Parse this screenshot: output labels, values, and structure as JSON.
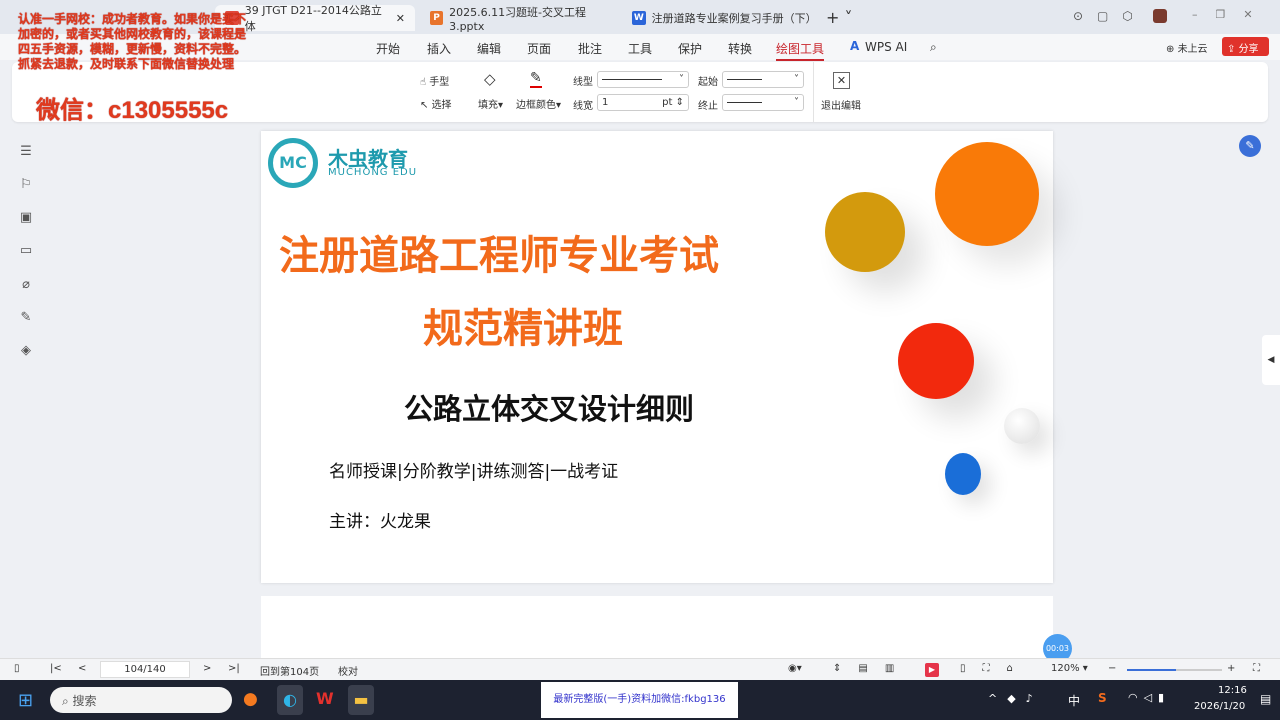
{
  "tabs": [
    {
      "label": "39 JTGT D21--2014公路立体",
      "icon": "pdf-icon"
    },
    {
      "label": "2025.6.11习题班-交叉工程3.pptx",
      "icon": "ppt-icon"
    },
    {
      "label": "注册道路专业案例复习手册（下）",
      "icon": "word-icon"
    }
  ],
  "menu": [
    "开始",
    "插入",
    "编辑",
    "页面",
    "批注",
    "工具",
    "保护",
    "转换",
    "绘图工具",
    "WPS AI"
  ],
  "menu_right": {
    "cloud": "未上云",
    "share": "分享"
  },
  "toolbar": {
    "hand": "手型",
    "select": "选择",
    "fill": "填充",
    "border_color": "边框颜色",
    "line_type": "线型",
    "line_width": "线宽",
    "width_value": "1",
    "unit": "pt",
    "start": "起始",
    "end": "终止",
    "exit": "退出编辑"
  },
  "overlay": {
    "text": "认准一手网校：成功者教育。如果你是买不加密的，或者买其他网校教育的，该课程是四五手资源，模糊，更新慢，资料不完整。抓紧去退款，及时联系下面微信替换处理",
    "wechat": "微信：c1305555c"
  },
  "slide": {
    "logo_cn": "木虫教育",
    "logo_en": "MUCHONG EDU",
    "logo_mark": "MC",
    "title1": "注册道路工程师专业考试",
    "title2": "规范精讲班",
    "subtitle": "公路立体交叉设计细则",
    "tagline": "名师授课|分阶教学|讲练测答|一战考证",
    "lecturer": "主讲：火龙果"
  },
  "status": {
    "page": "104/140",
    "back": "回到第104页",
    "proof": "校对",
    "zoom": "120%",
    "timer": "00:03"
  },
  "taskbar": {
    "search": "搜索",
    "banner": "最新完整版(一手)资料加微信:fkbg136",
    "time": "12:16",
    "date": "2026/1/20",
    "ime": "中"
  }
}
